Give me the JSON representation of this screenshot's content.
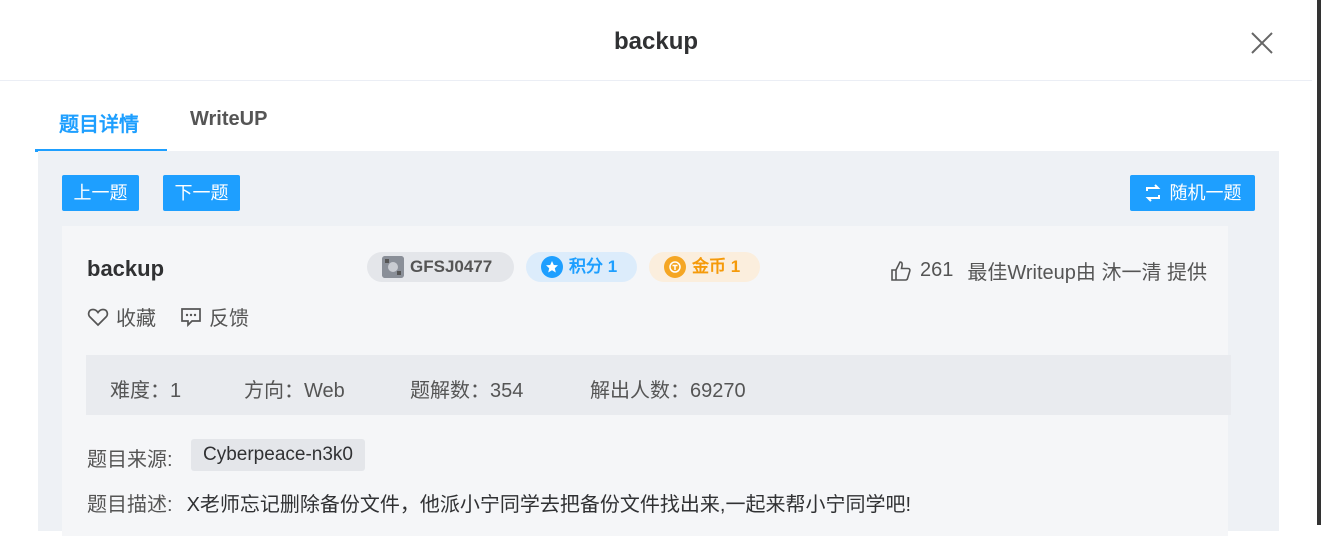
{
  "dialog": {
    "title": "backup"
  },
  "tabs": [
    {
      "label": "题目详情",
      "active": true
    },
    {
      "label": "WriteUP",
      "active": false
    }
  ],
  "toolbar": {
    "prev_label": "上一题",
    "next_label": "下一题",
    "random_label": "随机一题"
  },
  "challenge": {
    "name": "backup",
    "id": "GFSJ0477",
    "points_label": "积分 1",
    "coins_label": "金币 1",
    "likes": "261",
    "best_writeup": "最佳Writeup由 沐一清 提供",
    "favorite_label": "收藏",
    "feedback_label": "反馈",
    "stats": {
      "difficulty": "难度：1",
      "direction": "方向：Web",
      "solves": "题解数：354",
      "solvers": "解出人数：69270"
    },
    "source_label": "题目来源:",
    "source_value": "Cyberpeace-n3k0",
    "desc_label": "题目描述:",
    "desc_value": "X老师忘记删除备份文件，他派小宁同学去把备份文件找出来,一起来帮小宁同学吧!"
  },
  "colors": {
    "accent": "#1e9fff",
    "points_bg": "#dcecfb",
    "coins_bg": "#fbeedd",
    "coins_text": "#f59a0a",
    "id_bg": "#e4e6ea"
  },
  "icons": [
    "close-icon",
    "shuffle-icon",
    "star-badge-icon",
    "coin-icon",
    "thumbs-up-icon",
    "heart-icon",
    "comment-icon",
    "id-avatar-icon"
  ]
}
